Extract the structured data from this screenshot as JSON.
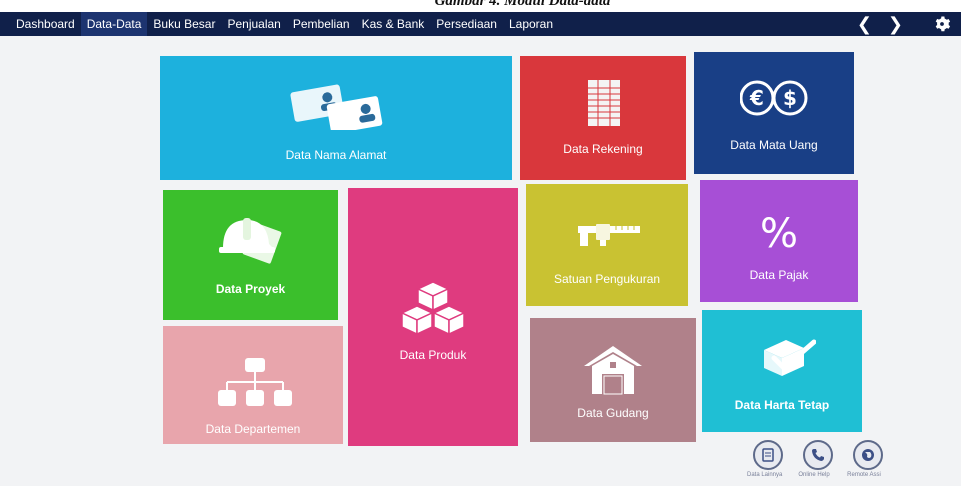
{
  "caption": "Gambar 4. Modul Data-data",
  "menu": {
    "items": [
      "Dashboard",
      "Data-Data",
      "Buku Besar",
      "Penjualan",
      "Pembelian",
      "Kas & Bank",
      "Persediaan",
      "Laporan"
    ],
    "active_index": 1
  },
  "nav": {
    "prev": "❮",
    "next": "❯"
  },
  "tiles": {
    "nama_alamat": {
      "label": "Data Nama Alamat",
      "color": "#1db1dd",
      "icon": "address-cards-icon"
    },
    "rekening": {
      "label": "Data Rekening",
      "color": "#d9373c",
      "icon": "ledger-book-icon"
    },
    "mata_uang": {
      "label": "Data Mata Uang",
      "color": "#193f86",
      "icon": "currency-icon"
    },
    "proyek": {
      "label": "Data Proyek",
      "color": "#3bbf2c",
      "icon": "helmet-blueprint-icon"
    },
    "produk": {
      "label": "Data Produk",
      "color": "#df3b7f",
      "icon": "boxes-icon"
    },
    "satuan": {
      "label": "Satuan Pengukuran",
      "color": "#c9c232",
      "icon": "caliper-icon"
    },
    "pajak": {
      "label": "Data Pajak",
      "color": "#a74fd6",
      "icon": "percent-icon"
    },
    "departemen": {
      "label": "Data Departemen",
      "color": "#e8a5ac",
      "icon": "org-chart-icon"
    },
    "gudang": {
      "label": "Data Gudang",
      "color": "#b0818a",
      "icon": "warehouse-icon"
    },
    "harta_tetap": {
      "label": "Data Harta Tetap",
      "color": "#1fbfd4",
      "icon": "asset-check-icon"
    }
  },
  "bottom": [
    {
      "label": "Data Lainnya",
      "icon": "notepad-icon"
    },
    {
      "label": "Online Help",
      "icon": "phone-icon"
    },
    {
      "label": "Remote Assi",
      "icon": "globe-icon"
    }
  ]
}
